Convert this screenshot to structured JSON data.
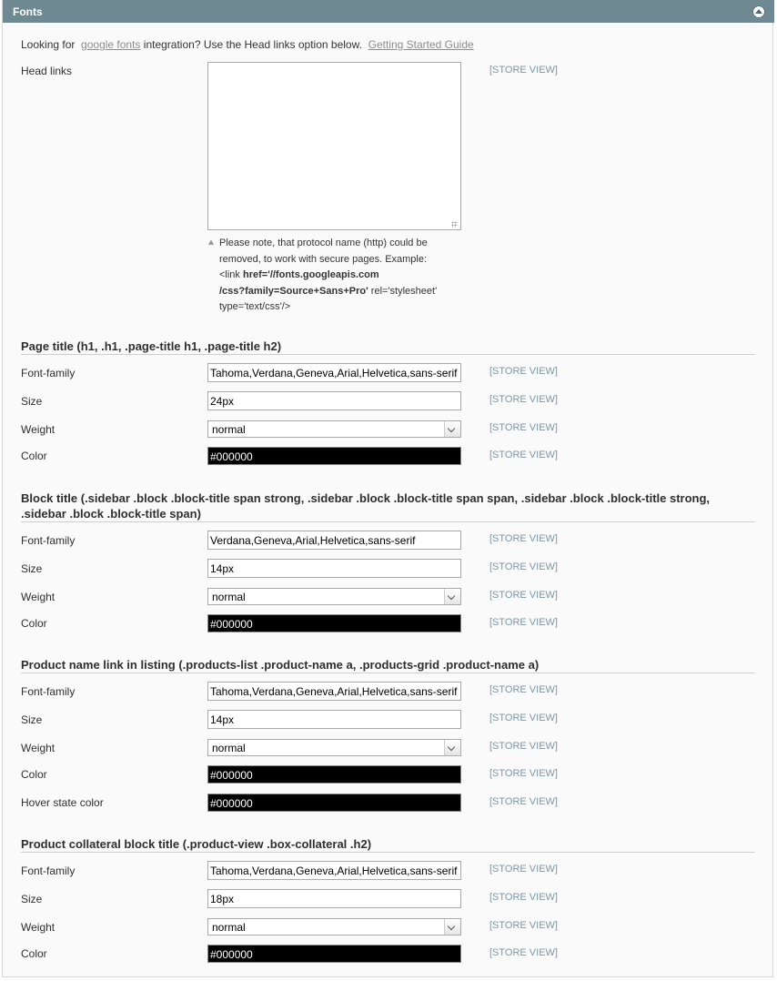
{
  "header": {
    "title": "Fonts"
  },
  "intro": {
    "prefix": "Looking for",
    "link1": "google fonts",
    "middle": "integration? Use the Head links option below.",
    "link2": "Getting Started Guide"
  },
  "head_links": {
    "label": "Head links",
    "value": "",
    "scope": "[STORE VIEW]",
    "note_line1": "Please note, that protocol name (http) could be",
    "note_line2": "removed, to work with secure pages. Example:",
    "note_line3a": "<link",
    "note_line3b": "href='//fonts.googleapis.com",
    "note_line4a": "/css?family=Source+Sans+Pro'",
    "note_line4b": "rel='stylesheet'",
    "note_line5": "type='text/css'/>"
  },
  "labels": {
    "font_family": "Font-family",
    "size": "Size",
    "weight": "Weight",
    "color": "Color",
    "hover_color": "Hover state color",
    "scope": "[STORE VIEW]"
  },
  "sections": [
    {
      "title": "Page title (h1, .h1, .page-title h1, .page-title h2)",
      "font_family": "Tahoma,Verdana,Geneva,Arial,Helvetica,sans-serif",
      "size": "24px",
      "weight": "normal",
      "color": "#000000"
    },
    {
      "title_line1": "Block title (.sidebar .block .block-title span strong, .sidebar .block .block-title span span, .sidebar .block .block-title strong,",
      "title_line2": ".sidebar .block .block-title span)",
      "font_family": "Verdana,Geneva,Arial,Helvetica,sans-serif",
      "size": "14px",
      "weight": "normal",
      "color": "#000000"
    },
    {
      "title": "Product name link in listing (.products-list .product-name a, .products-grid .product-name a)",
      "font_family": "Tahoma,Verdana,Geneva,Arial,Helvetica,sans-serif",
      "size": "14px",
      "weight": "normal",
      "color": "#000000",
      "hover_color": "#000000"
    },
    {
      "title": "Product collateral block title (.product-view .box-collateral .h2)",
      "font_family": "Tahoma,Verdana,Geneva,Arial,Helvetica,sans-serif",
      "size": "18px",
      "weight": "normal",
      "color": "#000000"
    }
  ]
}
